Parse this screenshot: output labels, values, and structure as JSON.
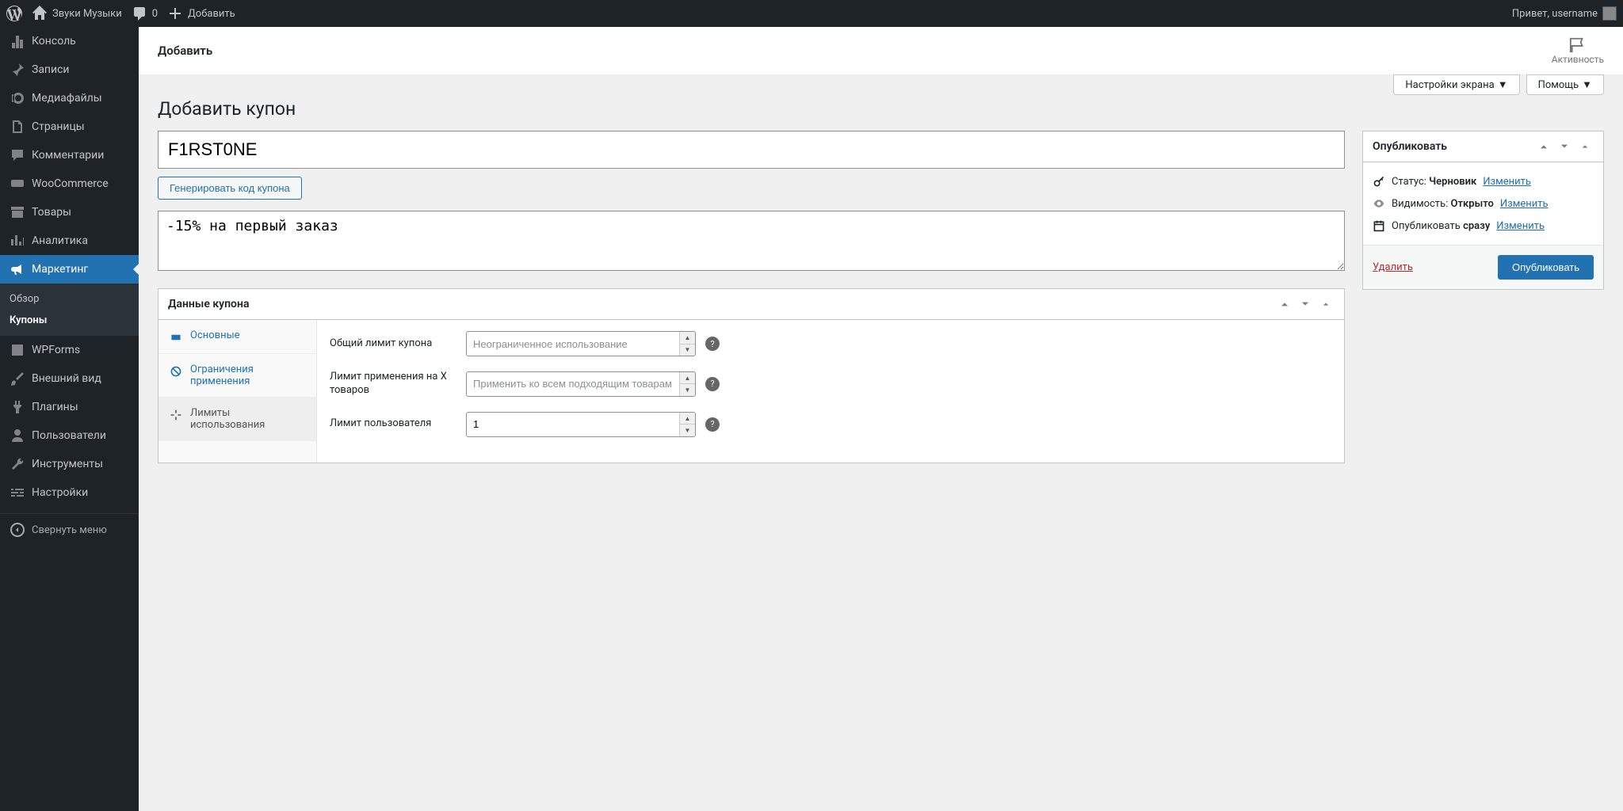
{
  "adminbar": {
    "site_name": "Звуки Музыки",
    "comments_count": "0",
    "add_new": "Добавить",
    "greeting": "Привет, username"
  },
  "sidebar": {
    "items": [
      {
        "key": "dashboard",
        "label": "Консоль"
      },
      {
        "key": "posts",
        "label": "Записи"
      },
      {
        "key": "media",
        "label": "Медиафайлы"
      },
      {
        "key": "pages",
        "label": "Страницы"
      },
      {
        "key": "comments",
        "label": "Комментарии"
      },
      {
        "key": "woocommerce",
        "label": "WooCommerce"
      },
      {
        "key": "products",
        "label": "Товары"
      },
      {
        "key": "analytics",
        "label": "Аналитика"
      },
      {
        "key": "marketing",
        "label": "Маркетинг"
      },
      {
        "key": "wpforms",
        "label": "WPForms"
      },
      {
        "key": "appearance",
        "label": "Внешний вид"
      },
      {
        "key": "plugins",
        "label": "Плагины"
      },
      {
        "key": "users",
        "label": "Пользователи"
      },
      {
        "key": "tools",
        "label": "Инструменты"
      },
      {
        "key": "settings",
        "label": "Настройки"
      }
    ],
    "submenu": {
      "overview": "Обзор",
      "coupons": "Купоны"
    },
    "collapse": "Свернуть меню"
  },
  "topbar": {
    "breadcrumb": "Добавить",
    "activity": "Активность"
  },
  "screen_options": {
    "settings": "Настройки экрана",
    "help": "Помощь"
  },
  "page": {
    "title": "Добавить купон",
    "coupon_code": "F1RST0NE",
    "generate_btn": "Генерировать код купона",
    "description": "-15% на первый заказ"
  },
  "coupon_data": {
    "panel_title": "Данные купона",
    "tabs": {
      "general": "Основные",
      "usage_restriction": "Ограничения применения",
      "usage_limits": "Лимиты использования"
    },
    "fields": {
      "total_limit": {
        "label": "Общий лимит купона",
        "placeholder": "Неограниченное использование"
      },
      "limit_x_items": {
        "label": "Лимит применения на X товаров",
        "placeholder": "Применить ко всем подходящим товарам"
      },
      "user_limit": {
        "label": "Лимит пользователя",
        "value": "1"
      }
    }
  },
  "publish": {
    "panel_title": "Опубликовать",
    "status_label": "Статус:",
    "status_value": "Черновик",
    "visibility_label": "Видимость:",
    "visibility_value": "Открыто",
    "publish_label": "Опубликовать",
    "publish_value": "сразу",
    "edit_link": "Изменить",
    "delete": "Удалить",
    "publish_btn": "Опубликовать"
  }
}
